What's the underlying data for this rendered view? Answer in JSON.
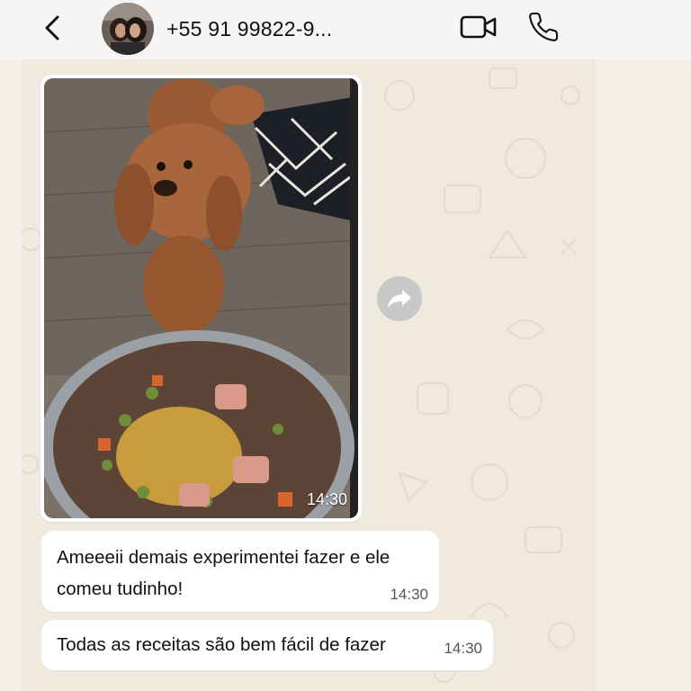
{
  "header": {
    "contact_name": "+55 91 99822-9...",
    "back_icon": "chevron-left-icon",
    "video_icon": "video-camera-icon",
    "call_icon": "phone-icon"
  },
  "messages": [
    {
      "type": "image",
      "time": "14:30"
    },
    {
      "type": "text",
      "lines": [
        "Ameeeii demais experimentei fazer e ele",
        "comeu tudinho!"
      ],
      "time": "14:30"
    },
    {
      "type": "text",
      "text": "Todas as receitas são bem fácil de fazer",
      "time": "14:30"
    }
  ],
  "colors": {
    "header_bg": "#f6f5f3",
    "chat_bg": "#efe9de",
    "bubble_bg": "#ffffff",
    "forward_bg": "#c8c8c8"
  }
}
